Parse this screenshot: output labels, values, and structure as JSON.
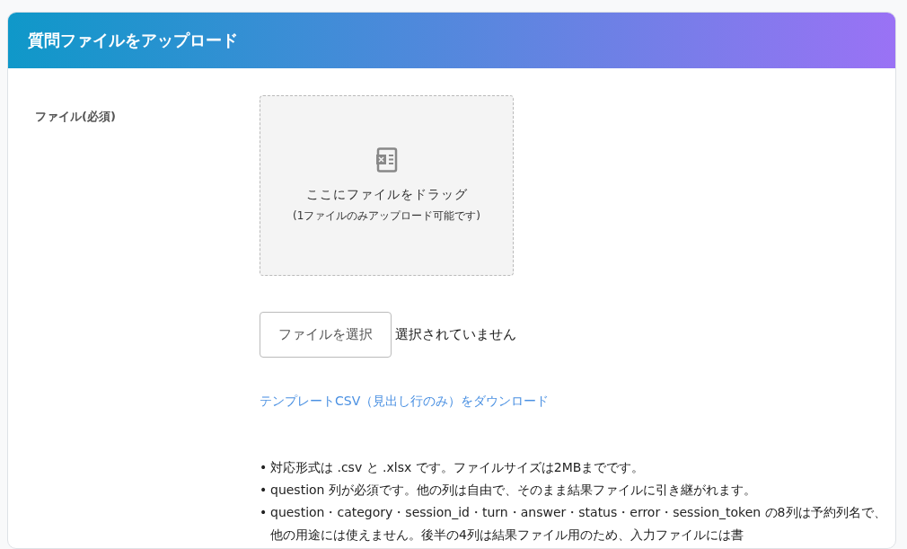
{
  "card": {
    "title": "質問ファイルをアップロード"
  },
  "field": {
    "label": "ファイル(必須)"
  },
  "dropzone": {
    "title": "ここにファイルをドラッグ",
    "note": "(1ファイルのみアップロード可能です)"
  },
  "file_input": {
    "button": "ファイルを選択",
    "status": "選択されていません"
  },
  "template_link": "テンプレートCSV（見出し行のみ）をダウンロード",
  "notes": [
    {
      "bullet": "•",
      "text": "対応形式は .csv と .xlsx です。ファイルサイズは2MBまでです。"
    },
    {
      "bullet": "•",
      "text": "question 列が必須です。他の列は自由で、そのまま結果ファイルに引き継がれます。"
    },
    {
      "bullet": "•",
      "text": "question・category・session_id・turn・answer・status・error・session_token の8列は予約列名で、他の用途には使えません。後半の4列は結果ファイル用のため、入力ファイルには書"
    }
  ]
}
